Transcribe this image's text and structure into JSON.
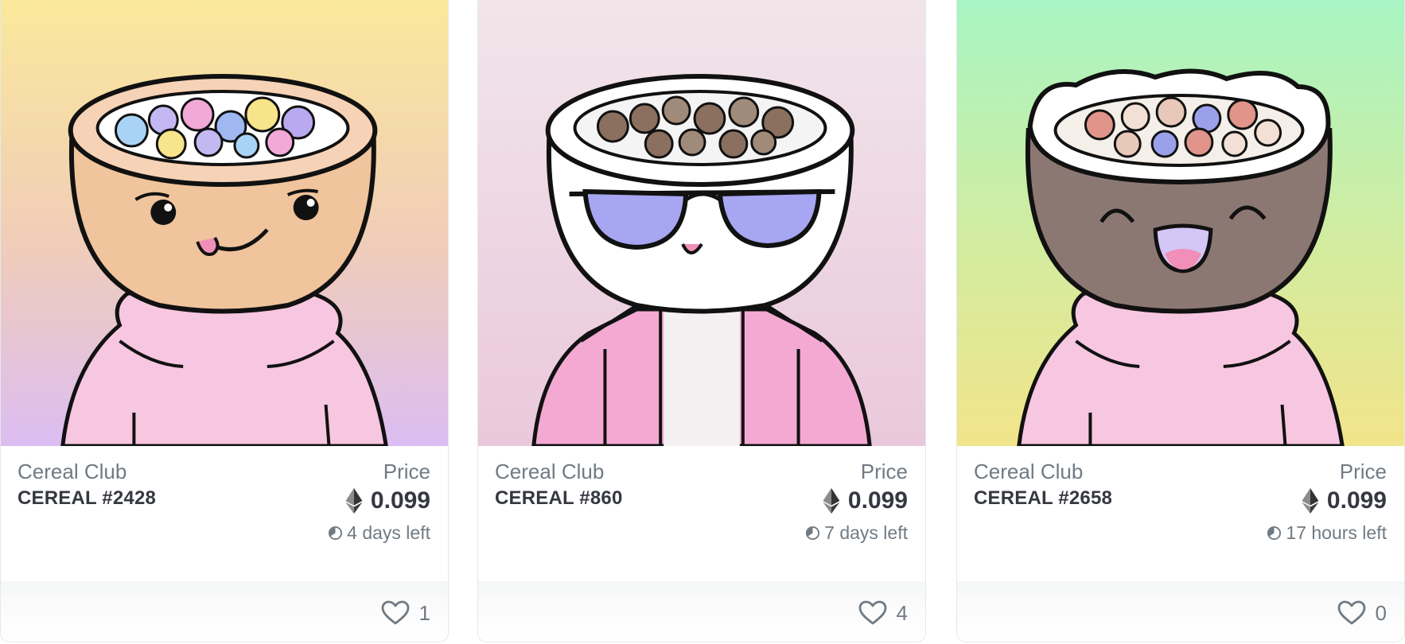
{
  "cards": [
    {
      "collection": "Cereal Club",
      "name": "CEREAL #2428",
      "price_label": "Price",
      "price": "0.099",
      "time_left": "4 days left",
      "likes": "1",
      "icons": {
        "currency": "ethereum-icon",
        "time": "clock-icon",
        "like": "heart-icon"
      },
      "colors": {
        "bg_top": "#fbe99a",
        "bg_bottom": "#dcbdf2",
        "bowl": "#f0c49c",
        "hoodie": "#f7c6e0"
      }
    },
    {
      "collection": "Cereal Club",
      "name": "CEREAL #860",
      "price_label": "Price",
      "price": "0.099",
      "time_left": "7 days left",
      "likes": "4",
      "icons": {
        "currency": "ethereum-icon",
        "time": "clock-icon",
        "like": "heart-icon"
      },
      "colors": {
        "bg_top": "#f1e6ea",
        "bg_bottom": "#eac8dc",
        "bowl": "#ffffff",
        "jacket": "#f3a9d2",
        "glasses": "#a6a6f2"
      }
    },
    {
      "collection": "Cereal Club",
      "name": "CEREAL #2658",
      "price_label": "Price",
      "price": "0.099",
      "time_left": "17 hours left",
      "likes": "0",
      "icons": {
        "currency": "ethereum-icon",
        "time": "clock-icon",
        "like": "heart-icon"
      },
      "colors": {
        "bg_top": "#a6f5c4",
        "bg_bottom": "#f2e48a",
        "bowl": "#8c7873",
        "hoodie": "#f7c6e0"
      }
    }
  ]
}
